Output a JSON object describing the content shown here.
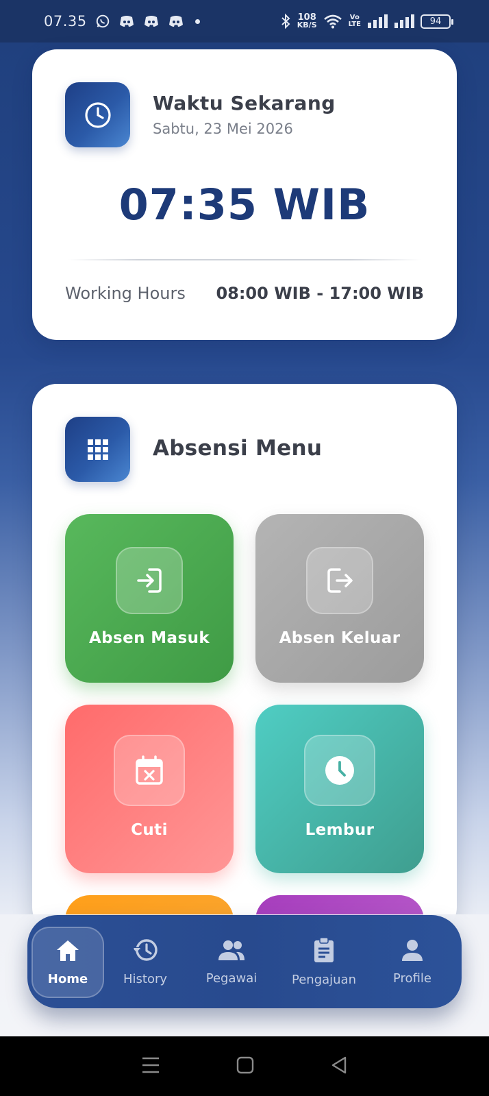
{
  "status_bar": {
    "time": "07.35",
    "net_speed_value": "108",
    "net_speed_unit": "KB/S",
    "volte_line1": "Vo",
    "volte_line2": "LTE",
    "battery": "94"
  },
  "time_card": {
    "title": "Waktu Sekarang",
    "date": "Sabtu, 23 Mei 2026",
    "clock": "07:35 WIB",
    "working_hours_label": "Working Hours",
    "working_hours_value": "08:00 WIB - 17:00 WIB",
    "icon": "clock-icon"
  },
  "menu_card": {
    "title": "Absensi Menu",
    "icon": "grid-icon",
    "items": [
      {
        "label": "Absen Masuk",
        "icon": "login-icon",
        "color": "#4caf50"
      },
      {
        "label": "Absen Keluar",
        "icon": "logout-icon",
        "color": "#a8a8a8"
      },
      {
        "label": "Cuti",
        "icon": "calendar-x-icon",
        "color": "#ff7b7b"
      },
      {
        "label": "Lembur",
        "icon": "clock-filled-icon",
        "color": "#47b8ad"
      }
    ]
  },
  "bottom_nav": {
    "items": [
      {
        "label": "Home",
        "icon": "home-icon",
        "active": true
      },
      {
        "label": "History",
        "icon": "history-icon"
      },
      {
        "label": "Pegawai",
        "icon": "people-icon"
      },
      {
        "label": "Pengajuan",
        "icon": "clipboard-icon"
      },
      {
        "label": "Profile",
        "icon": "person-icon"
      }
    ]
  },
  "colors": {
    "primary": "#1d3a78",
    "nav_bg": "#2b4f95",
    "status_bar_bg": "#1b3466"
  }
}
